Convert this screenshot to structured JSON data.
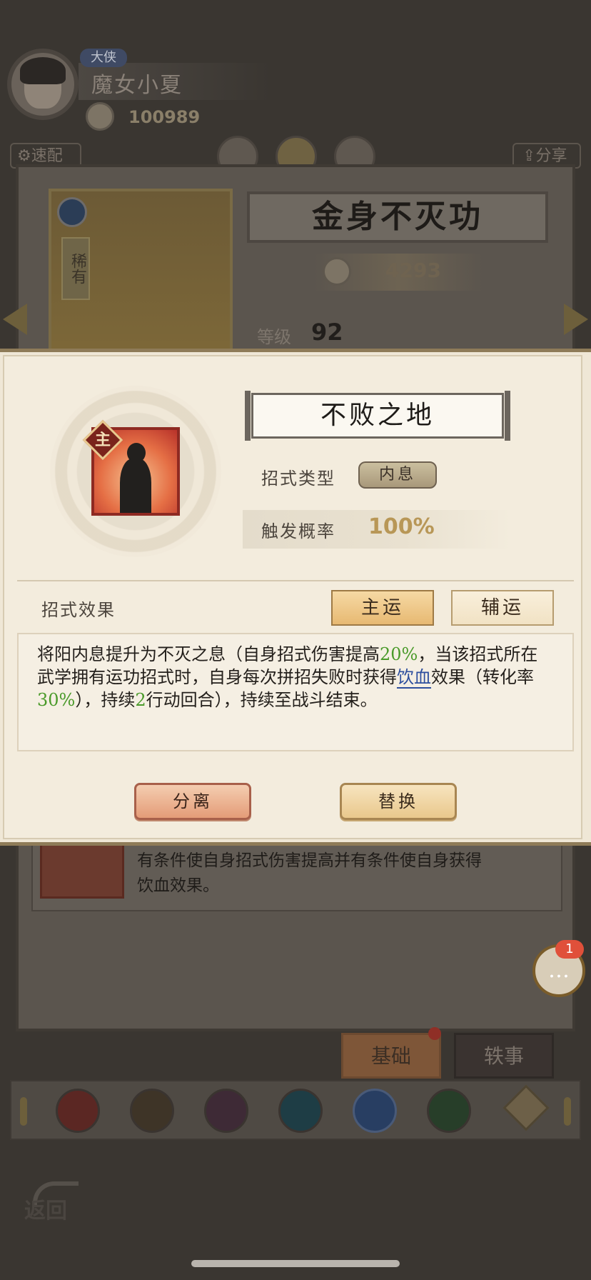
{
  "player": {
    "rank_tag": "大侠",
    "name": "魔女小夏",
    "coins": "100989"
  },
  "toolbar": {
    "speed_label": "速配",
    "share_label": "分享"
  },
  "technique": {
    "title": "金身不灭功",
    "power": "4293",
    "rarity": "稀有",
    "level_label": "等级",
    "level_value": "92"
  },
  "lower_skill": {
    "description": "有条件使自身招式伤害提高并有条件使自身获得饮血效果。"
  },
  "modal": {
    "badge": "主",
    "skill_name": "不败之地",
    "type_label": "招式类型",
    "type_value": "内息",
    "prob_label": "触发概率",
    "prob_value": "100%",
    "effect_label": "招式效果",
    "tab_main": "主运",
    "tab_aux": "辅运",
    "description": {
      "p1": "将阳内息提升为不灭之息（自身招式伤害提高",
      "v1": "20%",
      "p2": "，当该招式所在武学拥有运功招式时，自身每次拼招失败时获得",
      "link": "饮血",
      "p3": "效果（转化率",
      "v2": "30%",
      "p4": "），持续",
      "v3": "2",
      "p5": "行动回合），持续至战斗结束。"
    },
    "btn_separate": "分离",
    "btn_replace": "替换"
  },
  "chat": {
    "badge_count": "1"
  },
  "tabs": {
    "basic": "基础",
    "anecdote": "轶事"
  },
  "icon_strip": [
    "sword-icon",
    "sword-icon",
    "fist-icon",
    "fan-icon",
    "taiji-icon",
    "spiral-icon",
    "chevron-up-icon"
  ],
  "nav": {
    "back_label": "返回"
  },
  "colors": {
    "highlight_green": "#4a9a2a",
    "link_blue": "#2e4f9e",
    "main_button": "#e7b972",
    "separate_button": "#e49c78"
  }
}
